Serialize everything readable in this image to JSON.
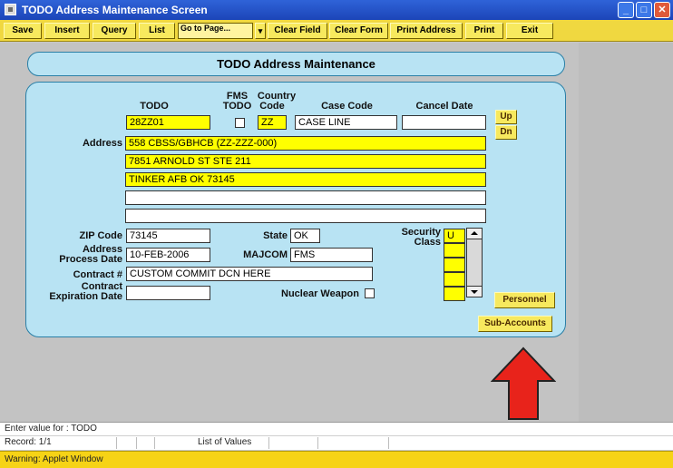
{
  "window": {
    "title": "TODO Address Maintenance Screen",
    "minimize_glyph": "_",
    "maximize_glyph": "□",
    "close_glyph": "✕"
  },
  "toolbar": {
    "save": "Save",
    "insert": "Insert",
    "query": "Query",
    "list": "List",
    "goto_page": "Go to Page...",
    "goto_arrow": "▾",
    "clear_field": "Clear Field",
    "clear_form": "Clear Form",
    "print_address": "Print Address",
    "print": "Print",
    "exit": "Exit"
  },
  "form": {
    "header": "TODO Address Maintenance",
    "labels": {
      "todo": "TODO",
      "fms_todo_line1": "FMS",
      "fms_todo_line2": "TODO",
      "country_code_line1": "Country",
      "country_code_line2": "Code",
      "case_code": "Case Code",
      "cancel_date": "Cancel Date",
      "address": "Address",
      "zip_code": "ZIP Code",
      "state": "State",
      "security_class_line1": "Security",
      "security_class_line2": "Class",
      "address_process_date_line1": "Address",
      "address_process_date_line2": "Process Date",
      "majcom": "MAJCOM",
      "contract_number": "Contract #",
      "contract_expiration_line1": "Contract",
      "contract_expiration_line2": "Expiration Date",
      "nuclear_weapon": "Nuclear Weapon"
    },
    "values": {
      "todo": "28ZZ01",
      "country_code": "ZZ",
      "case_code": "CASE LINE",
      "cancel_date": "",
      "address_lines": [
        "558 CBSS/GBHCB (ZZ-ZZZ-000)",
        "7851 ARNOLD ST STE 211",
        "TINKER AFB OK 73145",
        "",
        ""
      ],
      "zip_code": "73145",
      "state": "OK",
      "security_class": [
        "U",
        "",
        "",
        "",
        ""
      ],
      "address_process_date": "10-FEB-2006",
      "majcom": "FMS",
      "contract_number": "CUSTOM COMMIT DCN HERE",
      "contract_expiration_date": ""
    },
    "checkboxes": {
      "fms_todo": false,
      "nuclear_weapon": false
    },
    "buttons": {
      "up": "Up",
      "down": "Dn",
      "personnel": "Personnel",
      "sub_accounts": "Sub-Accounts"
    }
  },
  "status_bar": {
    "message": "Enter value for : TODO",
    "record": "Record: 1/1",
    "list_of_values": "List of Values"
  },
  "warning": "Warning: Applet Window",
  "colors": {
    "title_bar": "#1c45b8",
    "toolbar": "#f0d840",
    "panel": "#b8e3f3",
    "required_field": "#ffff00",
    "annotation_arrow": "#e8231b"
  },
  "icons": {
    "app": "app-window-icon",
    "annotation": "red-up-arrow-icon"
  }
}
